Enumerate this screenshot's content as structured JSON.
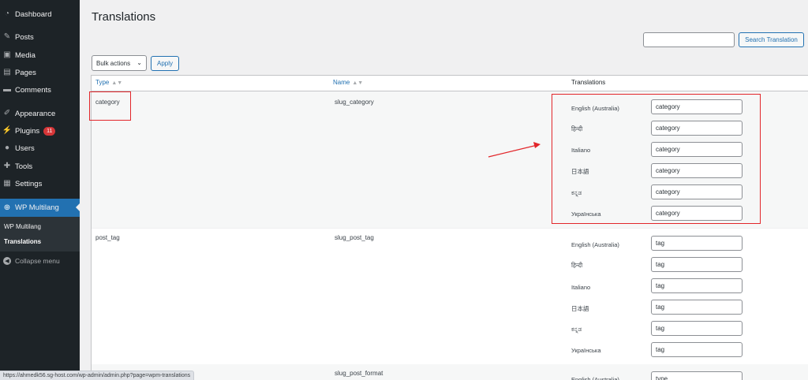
{
  "sidebar": {
    "items": [
      {
        "label": "Dashboard",
        "icon": "dashboard-icon"
      },
      {
        "label": "Posts",
        "icon": "pushpin-icon"
      },
      {
        "label": "Media",
        "icon": "media-icon"
      },
      {
        "label": "Pages",
        "icon": "pages-icon"
      },
      {
        "label": "Comments",
        "icon": "comments-icon"
      },
      {
        "label": "Appearance",
        "icon": "appearance-icon"
      },
      {
        "label": "Plugins",
        "icon": "plugins-icon",
        "badge": "11"
      },
      {
        "label": "Users",
        "icon": "users-icon"
      },
      {
        "label": "Tools",
        "icon": "tools-icon"
      },
      {
        "label": "Settings",
        "icon": "settings-icon"
      },
      {
        "label": "WP Multilang",
        "icon": "globe-icon"
      }
    ],
    "submenu": [
      "WP Multilang",
      "Translations"
    ],
    "collapse_label": "Collapse menu"
  },
  "page": {
    "title": "Translations",
    "search_button": "Search Translation",
    "search_value": "",
    "bulk_actions": "Bulk actions",
    "apply": "Apply"
  },
  "table": {
    "columns": [
      "Type",
      "Name",
      "Translations"
    ],
    "languages": [
      "English (Australia)",
      "हिन्दी",
      "Italiano",
      "日本語",
      "ಕನ್ನಡ",
      "Українська"
    ],
    "rows": [
      {
        "type": "category",
        "name": "slug_category",
        "values": [
          "category",
          "category",
          "category",
          "category",
          "category",
          "category"
        ]
      },
      {
        "type": "post_tag",
        "name": "slug_post_tag",
        "values": [
          "tag",
          "tag",
          "tag",
          "tag",
          "tag",
          "tag"
        ]
      },
      {
        "type": "",
        "name": "slug_post_format",
        "values": [
          "type"
        ]
      }
    ]
  },
  "status_bar": "https://ahmedk56.sg-host.com/wp-admin/admin.php?page=wpm-translations",
  "colors": {
    "sidebar": "#1d2327",
    "accent": "#2271b1",
    "annotation": "#e2262a",
    "badge": "#d63638"
  }
}
